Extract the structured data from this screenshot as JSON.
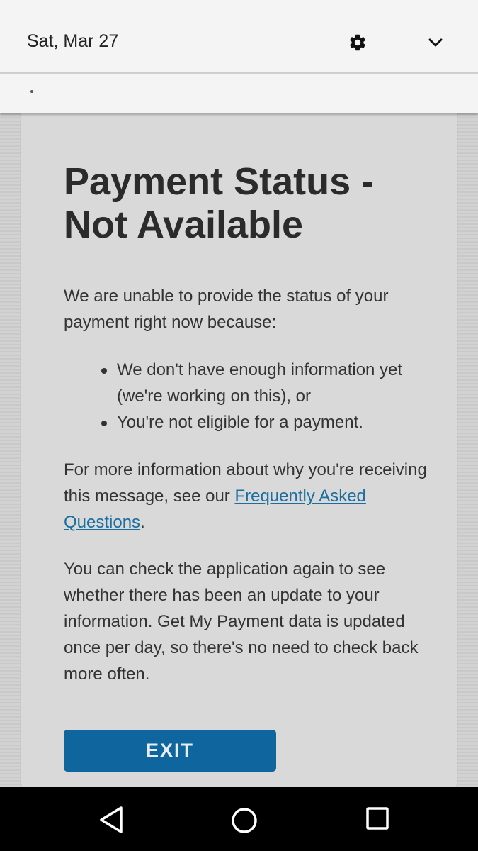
{
  "status_bar": {
    "date": "Sat, Mar 27",
    "icons": [
      "gear-icon",
      "chevron-down-icon"
    ]
  },
  "card": {
    "title": "Payment Status - Not Available",
    "intro": "We are unable to provide the status of your payment right now because:",
    "bullets": [
      "We don't have enough information yet (we're working on this), or",
      "You're not eligible for a payment."
    ],
    "more_info_prefix": "For more information about why you're receiving this message, see our ",
    "faq_link": "Frequently Asked Questions",
    "more_info_suffix": ".",
    "update_note": "You can check the application again to see whether there has been an update to your information. Get My Payment data is updated once per day, so there's no need to check back more often.",
    "exit_label": "EXIT"
  },
  "nav_bar": {
    "icons": [
      "back-icon",
      "home-icon",
      "recents-icon"
    ]
  },
  "colors": {
    "button": "#0f659e",
    "link": "#1a6ea0",
    "card": "#d9d9d9",
    "status_bar": "#f4f4f4"
  }
}
